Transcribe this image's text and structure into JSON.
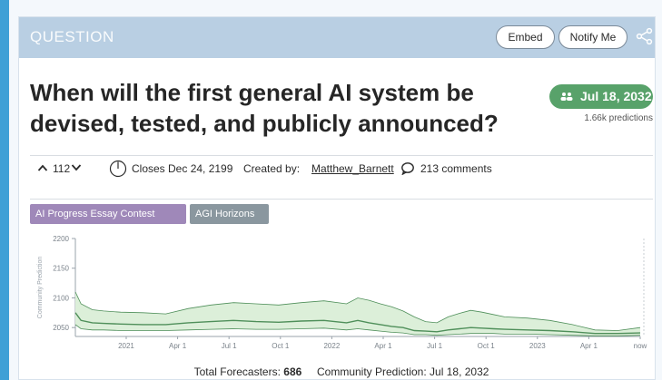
{
  "header": {
    "label": "QUESTION",
    "embed_label": "Embed",
    "notify_label": "Notify Me"
  },
  "question": {
    "title": "When will the first general AI system be devised, tested, and publicly announced?",
    "prediction": "Jul 18, 2032",
    "prediction_count": "1.66k predictions"
  },
  "meta": {
    "votes": "112",
    "closes": "Closes Dec 24, 2199",
    "created_label": "Created by:",
    "author": "Matthew_Barnett",
    "comments": "213 comments"
  },
  "tags": [
    "AI Progress Essay Contest",
    "AGI Horizons"
  ],
  "footer": {
    "forecasters_label": "Total Forecasters:",
    "forecasters_value": "686",
    "community_label": "Community Prediction:",
    "community_value": "Jul 18, 2032"
  },
  "colors": {
    "header_bg": "#b9cfe3",
    "prediction_green": "#58a26a",
    "band_fill": "#dcefd9",
    "band_stroke": "#4f8f5a",
    "tag_purple": "#9f88b9",
    "tag_gray": "#8a979f"
  },
  "chart_data": {
    "type": "area",
    "ylabel": "Community Prediction",
    "ylim": [
      2035,
      2200
    ],
    "yticks": [
      2050,
      2100,
      2150,
      2200
    ],
    "xtick_labels": [
      "2021",
      "Apr 1",
      "Jul 1",
      "Oct 1",
      "2022",
      "Apr 1",
      "Jul 1",
      "Oct 1",
      "2023",
      "Apr 1",
      "now"
    ],
    "x": [
      0,
      0.01,
      0.03,
      0.05,
      0.08,
      0.12,
      0.16,
      0.2,
      0.24,
      0.28,
      0.32,
      0.36,
      0.4,
      0.44,
      0.48,
      0.5,
      0.52,
      0.54,
      0.56,
      0.58,
      0.6,
      0.62,
      0.64,
      0.66,
      0.68,
      0.7,
      0.72,
      0.74,
      0.76,
      0.8,
      0.84,
      0.88,
      0.92,
      0.96,
      1.0
    ],
    "series": [
      {
        "name": "upper",
        "values": [
          2110,
          2090,
          2080,
          2078,
          2076,
          2075,
          2073,
          2082,
          2088,
          2092,
          2090,
          2088,
          2092,
          2095,
          2090,
          2100,
          2096,
          2090,
          2085,
          2078,
          2068,
          2060,
          2058,
          2068,
          2074,
          2079,
          2076,
          2072,
          2068,
          2066,
          2062,
          2055,
          2046,
          2045,
          2050
        ]
      },
      {
        "name": "median",
        "values": [
          2075,
          2062,
          2058,
          2057,
          2056,
          2055,
          2055,
          2058,
          2060,
          2062,
          2060,
          2059,
          2061,
          2062,
          2058,
          2062,
          2058,
          2055,
          2052,
          2050,
          2045,
          2044,
          2043,
          2046,
          2048,
          2050,
          2049,
          2048,
          2047,
          2046,
          2045,
          2043,
          2040,
          2040,
          2041
        ]
      },
      {
        "name": "lower",
        "values": [
          2055,
          2048,
          2046,
          2046,
          2045,
          2045,
          2045,
          2046,
          2047,
          2048,
          2047,
          2047,
          2048,
          2049,
          2046,
          2048,
          2046,
          2044,
          2042,
          2041,
          2038,
          2038,
          2037,
          2038,
          2039,
          2040,
          2040,
          2040,
          2039,
          2039,
          2038,
          2037,
          2036,
          2036,
          2037
        ]
      }
    ]
  }
}
